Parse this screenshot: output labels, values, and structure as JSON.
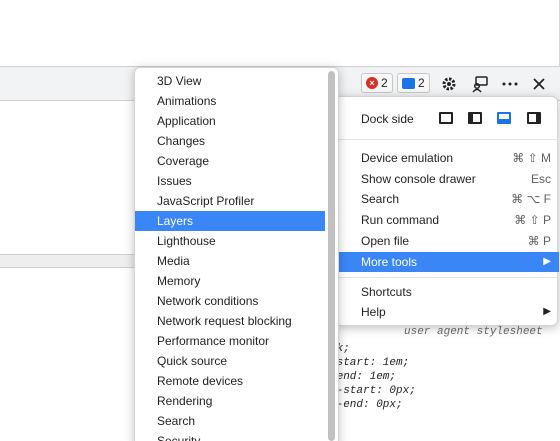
{
  "toolbar": {
    "error_count": "2",
    "message_count": "2",
    "settings_icon": "gear-icon",
    "feedback_icon": "feedback-icon",
    "more_icon": "more-icon",
    "close_icon": "close-icon"
  },
  "styles": {
    "source_label": "user agent stylesheet",
    "lines": [
      "ck;",
      "-start: 1em;",
      "-end: 1em;",
      "e-start: 0px;",
      "e-end: 0px;"
    ]
  },
  "main_menu": {
    "dock_side_label": "Dock side",
    "items": [
      {
        "label": "Device emulation",
        "shortcut": "⌘ ⇧ M"
      },
      {
        "label": "Show console drawer",
        "shortcut": "Esc"
      },
      {
        "label": "Search",
        "shortcut": "⌘ ⌥ F"
      },
      {
        "label": "Run command",
        "shortcut": "⌘ ⇧ P"
      },
      {
        "label": "Open file",
        "shortcut": "⌘ P"
      },
      {
        "label": "More tools",
        "shortcut": "▶"
      },
      {
        "label": "Shortcuts",
        "shortcut": ""
      },
      {
        "label": "Help",
        "shortcut": "▶"
      }
    ]
  },
  "more_tools": {
    "items": [
      "3D View",
      "Animations",
      "Application",
      "Changes",
      "Coverage",
      "Issues",
      "JavaScript Profiler",
      "Layers",
      "Lighthouse",
      "Media",
      "Memory",
      "Network conditions",
      "Network request blocking",
      "Performance monitor",
      "Quick source",
      "Remote devices",
      "Rendering",
      "Search",
      "Security"
    ],
    "selected": "Layers"
  },
  "colors": {
    "selection": "#3b86f7",
    "error": "#d93025",
    "message": "#1a73e8"
  }
}
